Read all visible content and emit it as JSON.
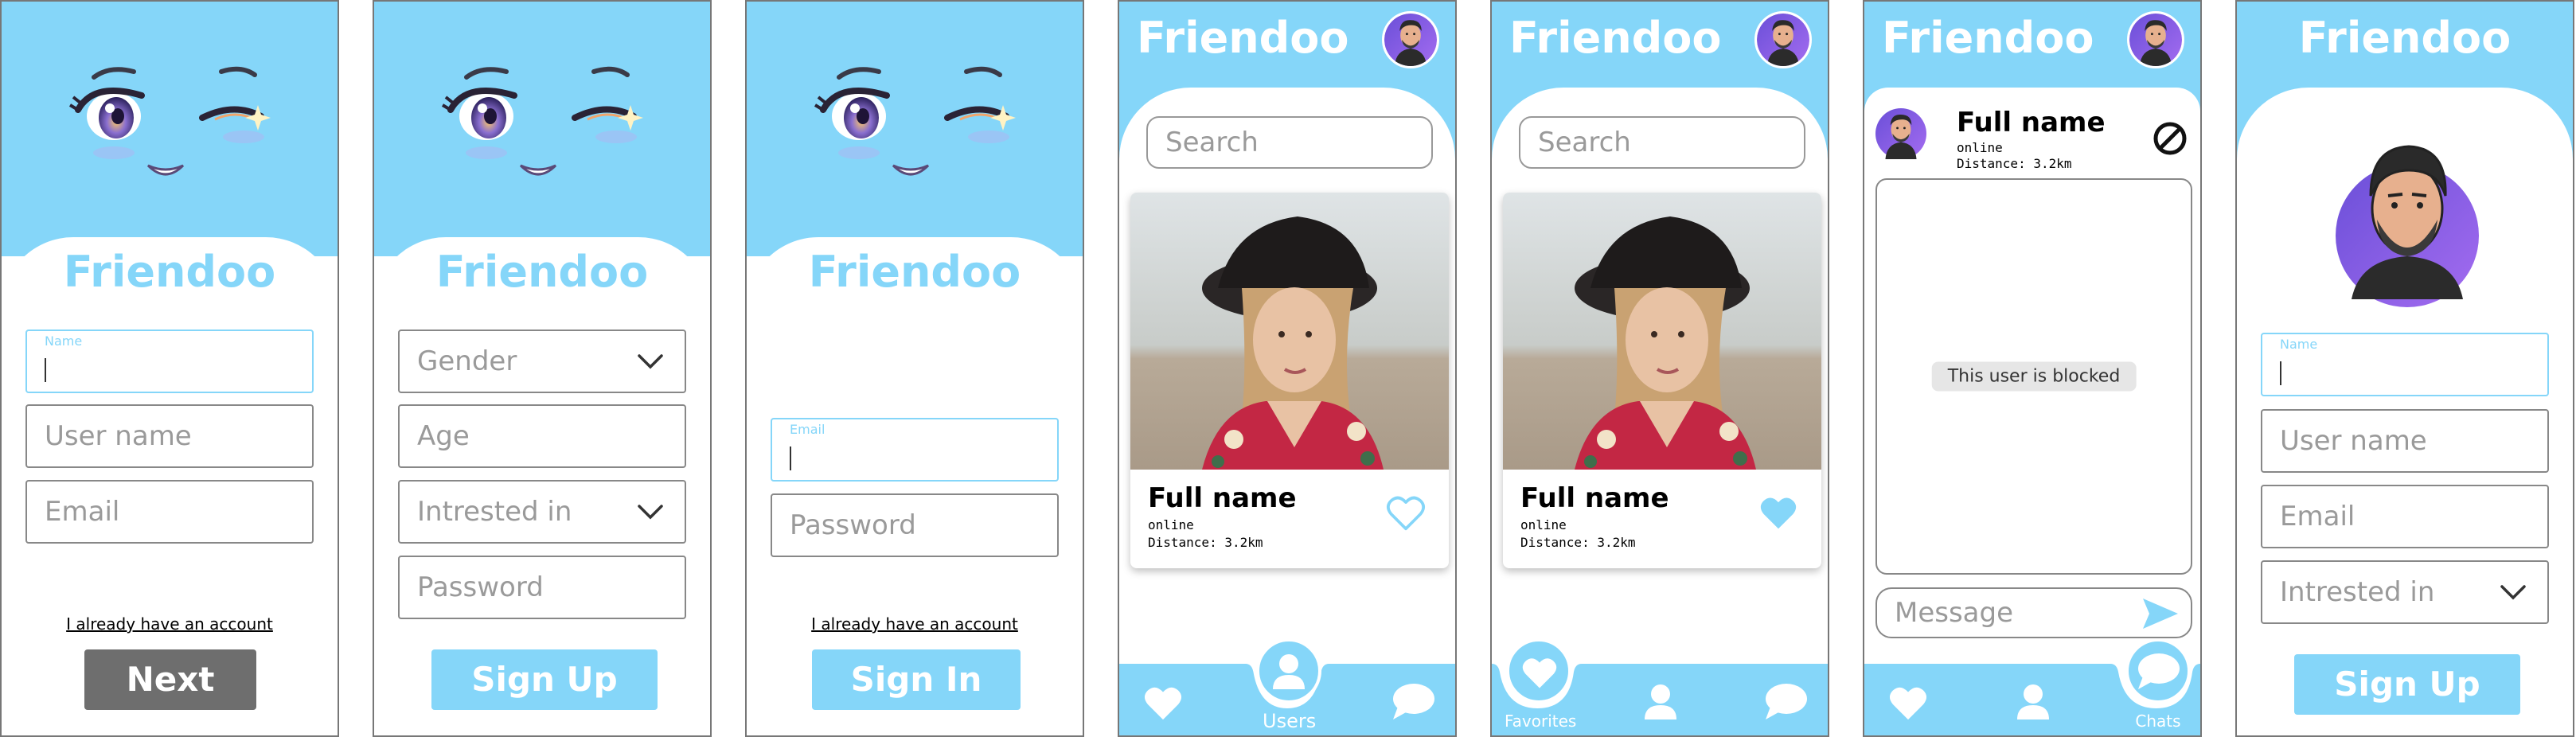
{
  "app": {
    "name": "Friendoo"
  },
  "colors": {
    "accent": "#85d6f9",
    "gray_button": "#6e6e6e",
    "border": "#888888"
  },
  "screen1": {
    "name_label": "Name",
    "fields": [
      "User name",
      "Email"
    ],
    "link": "I already have an account",
    "button": "Next"
  },
  "screen2": {
    "gender": "Gender",
    "age": "Age",
    "interested": "Intrested in",
    "password": "Password",
    "button": "Sign Up"
  },
  "screen3": {
    "email_label": "Email",
    "password": "Password",
    "link": "I already have an account",
    "button": "Sign In"
  },
  "screen4": {
    "search_placeholder": "Search",
    "card": {
      "name": "Full name",
      "status": "online",
      "distance": "Distance: 3.2km",
      "favorited": false
    },
    "nav": {
      "active": "Users",
      "label": "Users"
    }
  },
  "screen5": {
    "search_placeholder": "Search",
    "card": {
      "name": "Full name",
      "status": "online",
      "distance": "Distance: 3.2km",
      "favorited": true
    },
    "nav": {
      "active": "Favorites",
      "label": "Favorites"
    }
  },
  "screen6": {
    "user": {
      "name": "Full name",
      "status": "online",
      "distance": "Distance: 3.2km"
    },
    "blocked_text": "This user is blocked",
    "message_placeholder": "Message",
    "nav": {
      "active": "Chats",
      "label": "Chats"
    }
  },
  "screen7": {
    "name_label": "Name",
    "fields": [
      "User name",
      "Email"
    ],
    "interested": "Intrested in",
    "button": "Sign Up"
  }
}
